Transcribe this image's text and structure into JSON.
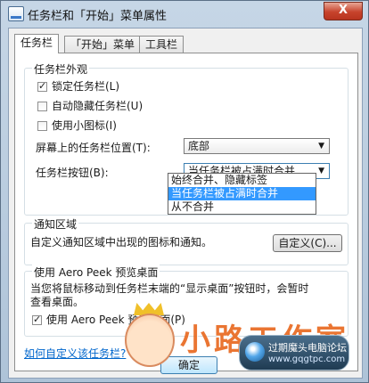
{
  "window": {
    "title": "任务栏和「开始」菜单属性",
    "close_label": "X"
  },
  "tabs": [
    {
      "label": "任务栏",
      "active": true
    },
    {
      "label": "「开始」菜单",
      "active": false
    },
    {
      "label": "工具栏",
      "active": false
    }
  ],
  "appearance": {
    "legend": "任务栏外观",
    "lock": {
      "label": "锁定任务栏(L)",
      "checked": true
    },
    "autohide": {
      "label": "自动隐藏任务栏(U)",
      "checked": false
    },
    "small_icons": {
      "label": "使用小图标(I)",
      "checked": false
    },
    "position": {
      "label": "屏幕上的任务栏位置(T):",
      "value": "底部"
    },
    "buttons": {
      "label": "任务栏按钮(B):",
      "value": "当任务栏被占满时合并",
      "options": [
        {
          "label": "始终合并、隐藏标签",
          "selected": false
        },
        {
          "label": "当任务栏被占满时合并",
          "selected": true
        },
        {
          "label": "从不合并",
          "selected": false
        }
      ]
    }
  },
  "notification": {
    "legend": "通知区域",
    "text": "自定义通知区域中出现的图标和通知。",
    "customize_label": "自定义(C)..."
  },
  "aero": {
    "legend": "使用 Aero Peek 预览桌面",
    "desc_line1": "当您将鼠标移动到任务栏末端的“显示桌面”按钮时，会暂时",
    "desc_line2": "查看桌面。",
    "checkbox": {
      "label": "使用 Aero Peek 预览桌面(P)",
      "checked": true
    }
  },
  "help_link": "如何自定义该任务栏?",
  "footer": {
    "ok_label": "确定"
  },
  "watermark": {
    "big_text": "小路工作室",
    "site_name": "过期魔头电脑论坛",
    "url": "www.gqgtpc.com"
  }
}
